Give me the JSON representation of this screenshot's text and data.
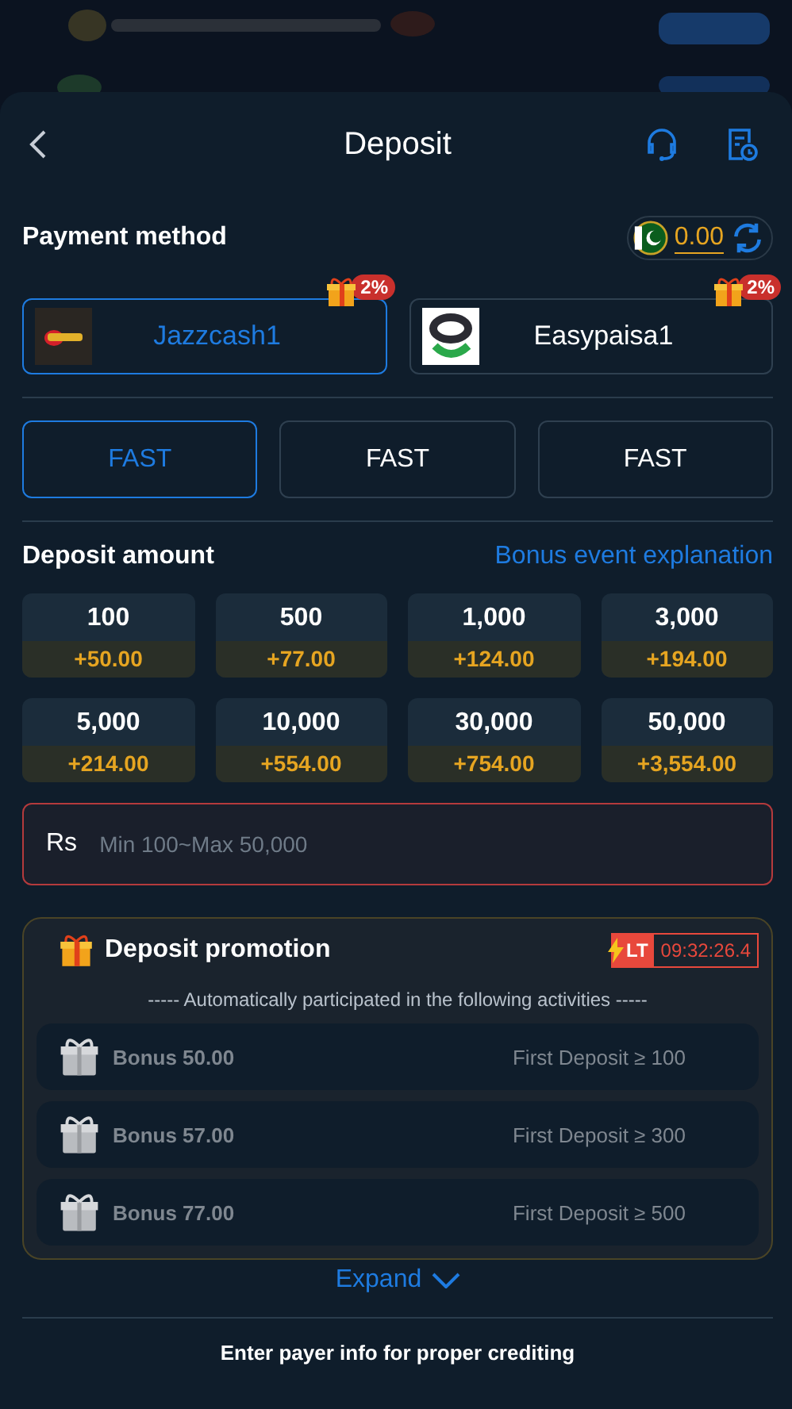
{
  "header": {
    "title": "Deposit"
  },
  "payment_method": {
    "label": "Payment method",
    "balance": "0.00"
  },
  "methods": [
    {
      "name": "Jazzcash1",
      "badge": "2%",
      "selected": true,
      "kind": "jazz"
    },
    {
      "name": "Easypaisa1",
      "badge": "2%",
      "selected": false,
      "kind": "easy"
    }
  ],
  "channels": [
    {
      "label": "FAST",
      "selected": true
    },
    {
      "label": "FAST",
      "selected": false
    },
    {
      "label": "FAST",
      "selected": false
    }
  ],
  "deposit_amount": {
    "label": "Deposit amount",
    "link": "Bonus event explanation"
  },
  "amounts": [
    {
      "amount": "100",
      "bonus": "+50.00"
    },
    {
      "amount": "500",
      "bonus": "+77.00"
    },
    {
      "amount": "1,000",
      "bonus": "+124.00"
    },
    {
      "amount": "3,000",
      "bonus": "+194.00"
    },
    {
      "amount": "5,000",
      "bonus": "+214.00"
    },
    {
      "amount": "10,000",
      "bonus": "+554.00"
    },
    {
      "amount": "30,000",
      "bonus": "+754.00"
    },
    {
      "amount": "50,000",
      "bonus": "+3,554.00"
    }
  ],
  "amount_field": {
    "currency": "Rs",
    "placeholder": "Min 100~Max 50,000"
  },
  "promotion": {
    "title": "Deposit promotion",
    "tag": "LT",
    "timer": "09:32:26.4",
    "note": "----- Automatically participated in the following activities -----",
    "items": [
      {
        "bonus": "Bonus 50.00",
        "condition": "First Deposit ≥ 100"
      },
      {
        "bonus": "Bonus 57.00",
        "condition": "First Deposit ≥ 300"
      },
      {
        "bonus": "Bonus 77.00",
        "condition": "First Deposit ≥ 500"
      }
    ],
    "expand": "Expand"
  },
  "payer_info": {
    "title": "Enter payer info for proper crediting"
  }
}
